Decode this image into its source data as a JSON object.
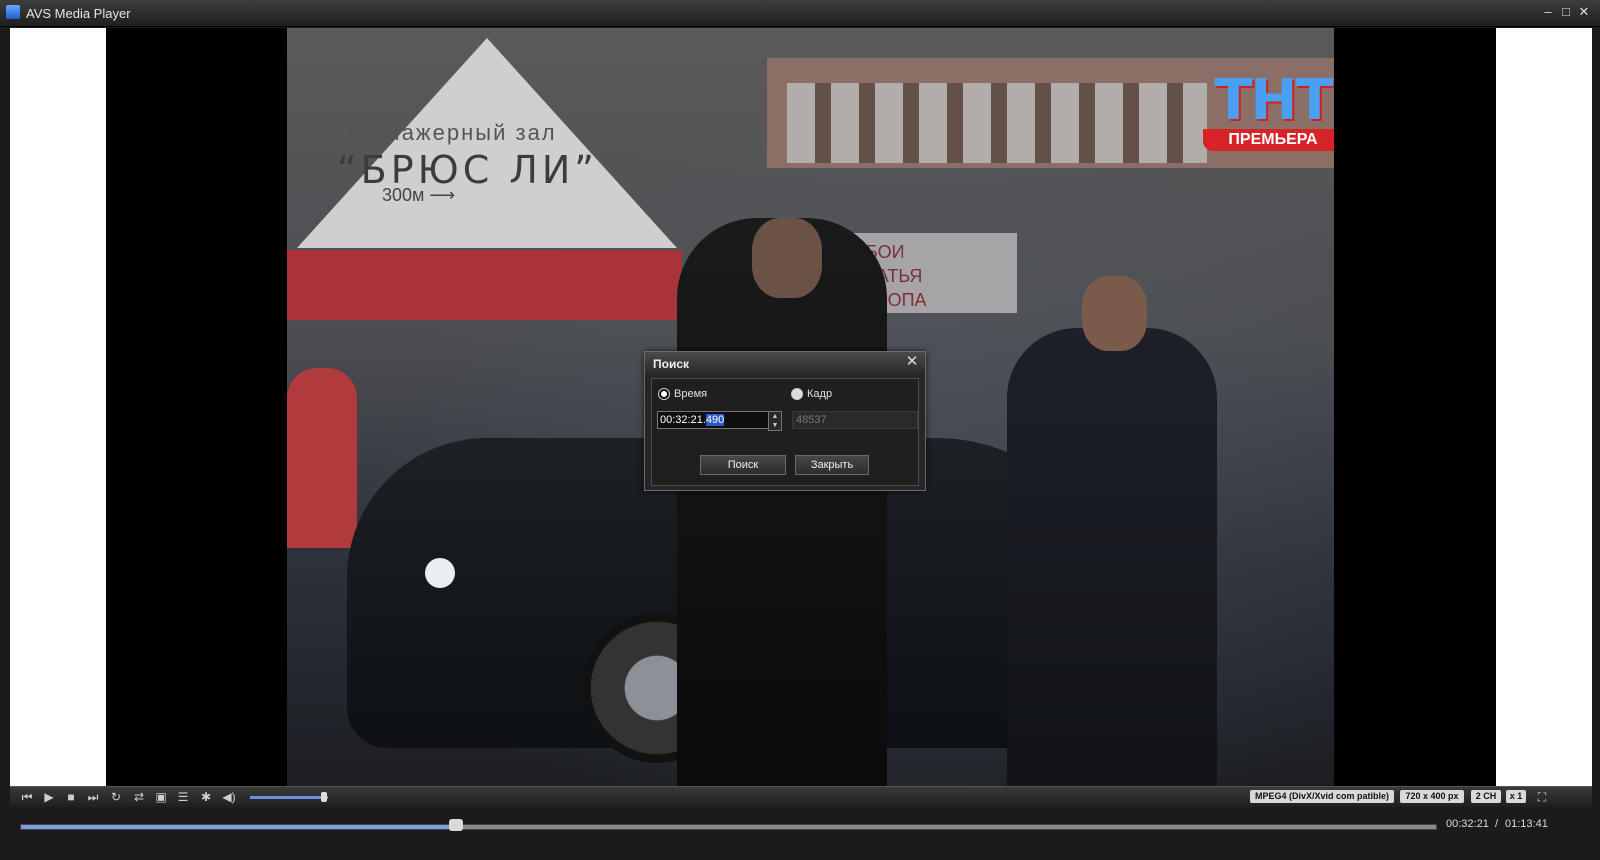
{
  "window": {
    "title": "AVS Media Player",
    "minimize_glyph": "‒",
    "maximize_glyph": "□",
    "close_glyph": "✕"
  },
  "video": {
    "sign_line1": "тренажерный зал",
    "sign_line2": "“БРЮС ЛИ”",
    "sign_line3": "300м ⟶",
    "poster_text": "ОБОИ\nПЛАТЬЯ\nЕВРОПА",
    "channel_logo": {
      "name": "ТНТ",
      "caption": "ПРЕМЬЕРА"
    }
  },
  "search_dialog": {
    "title": "Поиск",
    "close_glyph": "✕",
    "time_option_label": "Время",
    "frame_option_label": "Кадр",
    "time_option_selected": true,
    "time_value_prefix": "00:32:21.",
    "time_value_selected": "490",
    "frame_value": "48537",
    "search_button": "Поиск",
    "close_button": "Закрыть"
  },
  "controls": {
    "icons": [
      "previous-icon",
      "play-icon",
      "stop-icon",
      "next-icon",
      "repeat-icon",
      "shuffle-icon",
      "snapshot-icon",
      "playlist-icon",
      "settings-icon",
      "volume-icon"
    ],
    "volume_level": 0.95,
    "badges": {
      "codec": "MPEG4  (DivX/Xvid  com patible)",
      "resolution": "720 x 400 px",
      "channels": "2 CH",
      "speed": "x 1"
    },
    "fullscreen_glyph": "⛶"
  },
  "progress": {
    "fraction": 0.308,
    "current_time": "00:32:21",
    "separator": "/",
    "total_time": "01:13:41"
  },
  "colors": {
    "accent": "#2a59c9",
    "progress_fill": "#7e9be0"
  }
}
